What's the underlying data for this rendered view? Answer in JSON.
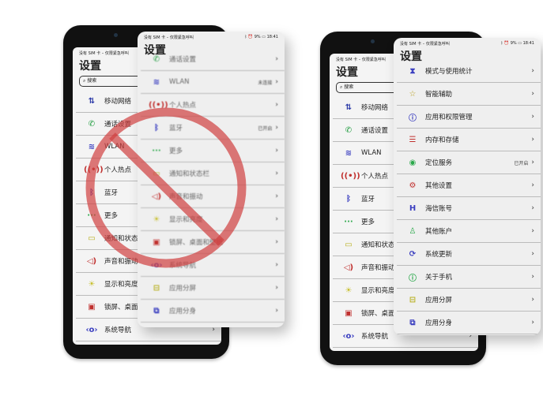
{
  "status": {
    "left": "没有 SIM 卡 – 仅限紧急呼叫",
    "battery": "9%",
    "time": "18:41"
  },
  "title": "设置",
  "search_placeholder": "搜索",
  "phone_items": [
    {
      "icon": "swap-icon",
      "g": "⇅",
      "c": "#2b3aa8",
      "label": "移动网络"
    },
    {
      "icon": "phone-icon",
      "g": "✆",
      "c": "#1a9a3a",
      "label": "通话设置"
    },
    {
      "icon": "wifi-icon",
      "g": "≋",
      "c": "#3b3fc0",
      "label": "WLAN"
    },
    {
      "icon": "hotspot-icon",
      "g": "((•))",
      "c": "#c0302e",
      "label": "个人热点"
    },
    {
      "icon": "bluetooth-icon",
      "g": "ᛒ",
      "c": "#3b3fc0",
      "label": "蓝牙"
    },
    {
      "icon": "more-icon",
      "g": "···",
      "c": "#2aa84a",
      "label": "更多"
    },
    {
      "icon": "notification-icon",
      "g": "▭",
      "c": "#b8b020",
      "label": "通知和状态栏"
    },
    {
      "icon": "sound-icon",
      "g": "◁)",
      "c": "#c0302e",
      "label": "声音和振动"
    },
    {
      "icon": "brightness-icon",
      "g": "☀",
      "c": "#c8c030",
      "label": "显示和亮度"
    },
    {
      "icon": "wallpaper-icon",
      "g": "▣",
      "c": "#c0302e",
      "label": "锁屏、桌面和壁纸"
    },
    {
      "icon": "navigation-icon",
      "g": "‹o›",
      "c": "#3b3fc0",
      "label": "系统导航"
    }
  ],
  "wrong_card_items": [
    {
      "icon": "phone-icon",
      "g": "✆",
      "c": "#1a9a3a",
      "label": "通话设置"
    },
    {
      "icon": "wifi-icon",
      "g": "≋",
      "c": "#3b3fc0",
      "label": "WLAN",
      "status": "未连接"
    },
    {
      "icon": "hotspot-icon",
      "g": "((•))",
      "c": "#c0302e",
      "label": "个人热点"
    },
    {
      "icon": "bluetooth-icon",
      "g": "ᛒ",
      "c": "#3b3fc0",
      "label": "蓝牙",
      "status": "已开启"
    },
    {
      "icon": "more-icon",
      "g": "···",
      "c": "#2aa84a",
      "label": "更多"
    },
    {
      "icon": "notification-icon",
      "g": "▭",
      "c": "#b8b020",
      "label": "通知和状态栏"
    },
    {
      "icon": "sound-icon",
      "g": "◁)",
      "c": "#c0302e",
      "label": "声音和振动"
    },
    {
      "icon": "brightness-icon",
      "g": "☀",
      "c": "#c8c030",
      "label": "显示和亮度"
    },
    {
      "icon": "wallpaper-icon",
      "g": "▣",
      "c": "#c0302e",
      "label": "锁屏、桌面和壁纸"
    },
    {
      "icon": "navigation-icon",
      "g": "‹o›",
      "c": "#3b3fc0",
      "label": "系统导航"
    },
    {
      "icon": "split-screen-icon",
      "g": "⊟",
      "c": "#b8b020",
      "label": "应用分屏"
    },
    {
      "icon": "app-clone-icon",
      "g": "⧉",
      "c": "#3b3fc0",
      "label": "应用分身"
    }
  ],
  "right_card_items": [
    {
      "icon": "hourglass-icon",
      "g": "⧗",
      "c": "#3b3fc0",
      "label": "模式与使用统计"
    },
    {
      "icon": "star-icon",
      "g": "☆",
      "c": "#b8a020",
      "label": "智能辅助"
    },
    {
      "icon": "permission-icon",
      "g": "ⓘ",
      "c": "#3b3fc0",
      "label": "应用和权限管理"
    },
    {
      "icon": "storage-icon",
      "g": "☰",
      "c": "#c0302e",
      "label": "内存和存储"
    },
    {
      "icon": "location-icon",
      "g": "◉",
      "c": "#2aa84a",
      "label": "定位服务",
      "status": "已开启"
    },
    {
      "icon": "settings-icon",
      "g": "⚙",
      "c": "#c0302e",
      "label": "其他设置"
    },
    {
      "icon": "hisense-account-icon",
      "g": "H",
      "c": "#3b3fc0",
      "label": "海信账号"
    },
    {
      "icon": "user-icon",
      "g": "♙",
      "c": "#2aa84a",
      "label": "其他账户"
    },
    {
      "icon": "update-icon",
      "g": "⟳",
      "c": "#3b3fc0",
      "label": "系统更新"
    },
    {
      "icon": "info-icon",
      "g": "ⓘ",
      "c": "#2aa84a",
      "label": "关于手机"
    },
    {
      "icon": "split-screen-icon",
      "g": "⊟",
      "c": "#b8b020",
      "label": "应用分屏"
    },
    {
      "icon": "app-clone-icon",
      "g": "⧉",
      "c": "#3b3fc0",
      "label": "应用分身"
    }
  ],
  "ban_color": "#d04040"
}
